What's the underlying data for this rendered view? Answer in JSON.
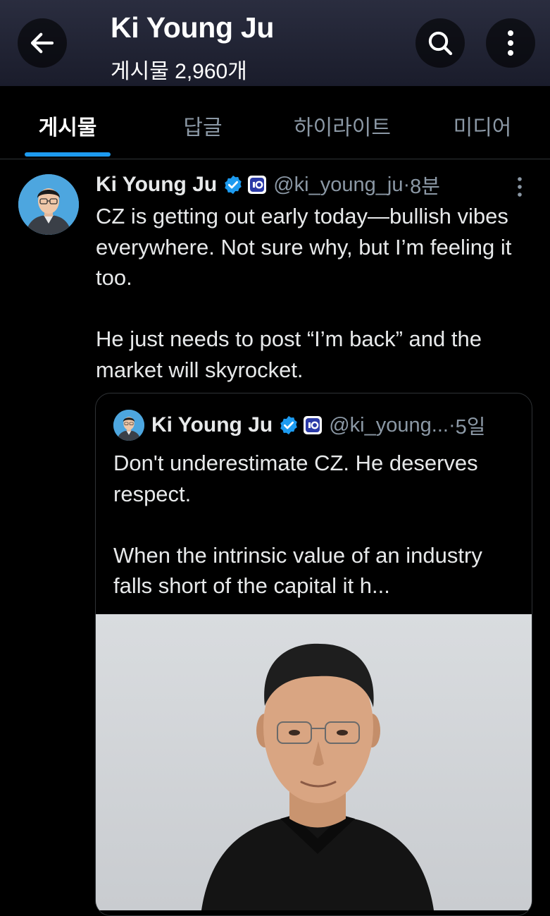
{
  "header": {
    "title": "Ki Young Ju",
    "post_count": "게시물 2,960개",
    "back_icon": "arrow-left-icon",
    "search_icon": "search-icon",
    "more_icon": "more-vertical-icon"
  },
  "tabs": [
    {
      "label": "게시물",
      "active": true
    },
    {
      "label": "답글",
      "active": false
    },
    {
      "label": "하이라이트",
      "active": false
    },
    {
      "label": "미디어",
      "active": false
    }
  ],
  "post": {
    "author_name": "Ki Young Ju",
    "handle": "@ki_young_ju",
    "separator": " · ",
    "time": "8분",
    "verified_icon": "verified-badge-icon",
    "affiliation_icon": "cryptoquant-logo-icon",
    "text_p1": "CZ is getting out early today—bullish vibes everywhere. Not sure why, but I’m feeling it too.",
    "text_p2": "He just needs to post “I’m back” and the market will skyrocket.",
    "quote": {
      "author_name": "Ki Young Ju",
      "handle": "@ki_young...",
      "separator": " · ",
      "time": "5일",
      "text_p1": "Don't underestimate CZ. He deserves respect.",
      "text_p2": "When the intrinsic value of an industry falls short of the capital it h..."
    }
  },
  "colors": {
    "accent": "#1d9bf0",
    "background": "#000000",
    "text_primary": "#e7e9ea",
    "text_secondary": "#8b98a5",
    "divider": "#2f3336"
  }
}
